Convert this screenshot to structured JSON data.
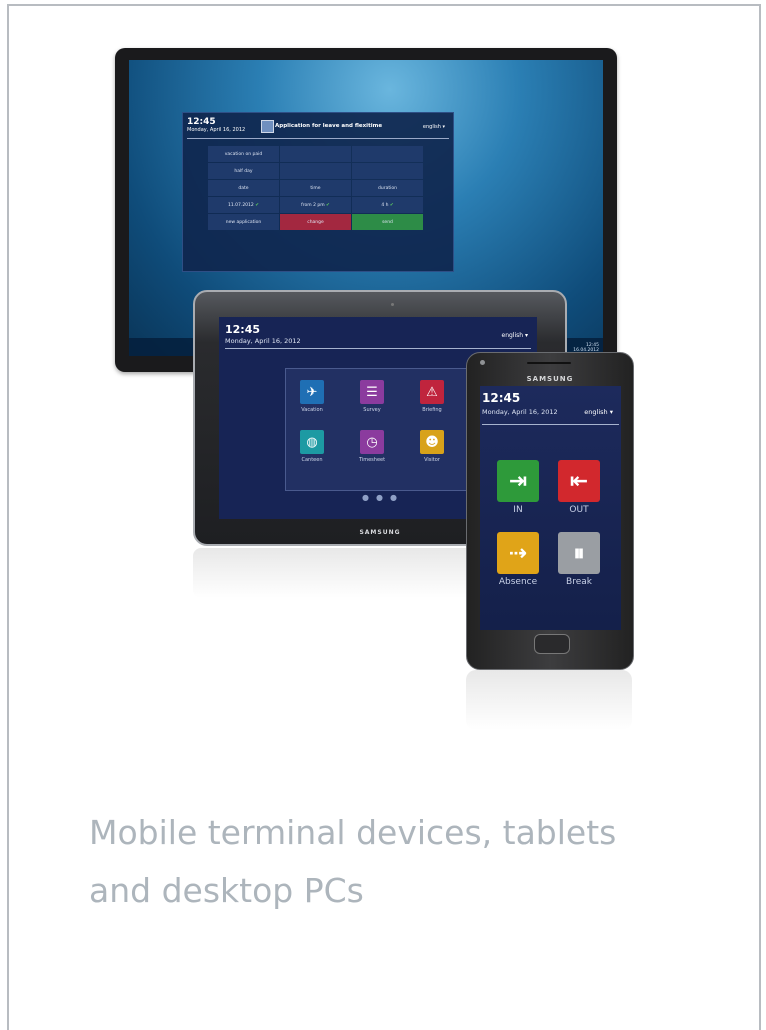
{
  "desktop": {
    "time": "12:45",
    "date": "Monday, April 16, 2012",
    "title": "Application for leave and flexitime",
    "language": "english",
    "rows": [
      [
        "vacation on paid",
        "",
        ""
      ],
      [
        "half day",
        "",
        ""
      ],
      [
        "date",
        "time",
        "duration"
      ],
      [
        "11.07.2012",
        "from 2 pm",
        "4 h"
      ],
      [
        "new application",
        "change",
        "send"
      ]
    ],
    "tray_time": "12:45",
    "tray_date": "16.04.2012"
  },
  "tablet": {
    "time": "12:45",
    "date": "Monday, April 16, 2012",
    "language": "english",
    "brand": "SAMSUNG",
    "tiles": [
      {
        "label": "Vacation",
        "icon": "vacation-icon",
        "color": "#1f6fb4"
      },
      {
        "label": "Survey",
        "icon": "survey-icon",
        "color": "#8b3b9e"
      },
      {
        "label": "Briefing",
        "icon": "warning-icon",
        "color": "#c0243d"
      },
      {
        "label": "Canteen",
        "icon": "canteen-icon",
        "color": "#1d9aa3"
      },
      {
        "label": "Timesheet",
        "icon": "timesheet-icon",
        "color": "#8b3b9e"
      },
      {
        "label": "Visitor",
        "icon": "visitor-icon",
        "color": "#d8a21a"
      }
    ]
  },
  "phone": {
    "brand": "SAMSUNG",
    "time": "12:45",
    "date": "Monday, April 16, 2012",
    "language": "english",
    "buttons": [
      {
        "label": "IN",
        "icon": "enter-icon",
        "color": "#2e9a3a"
      },
      {
        "label": "OUT",
        "icon": "exit-icon",
        "color": "#d2282d"
      },
      {
        "label": "Absence",
        "icon": "absence-icon",
        "color": "#e0a418"
      },
      {
        "label": "Break",
        "icon": "pause-icon",
        "color": "#9a9ea3"
      }
    ]
  },
  "caption": {
    "line1": "Mobile terminal devices, tablets",
    "line2": "and desktop PCs"
  }
}
